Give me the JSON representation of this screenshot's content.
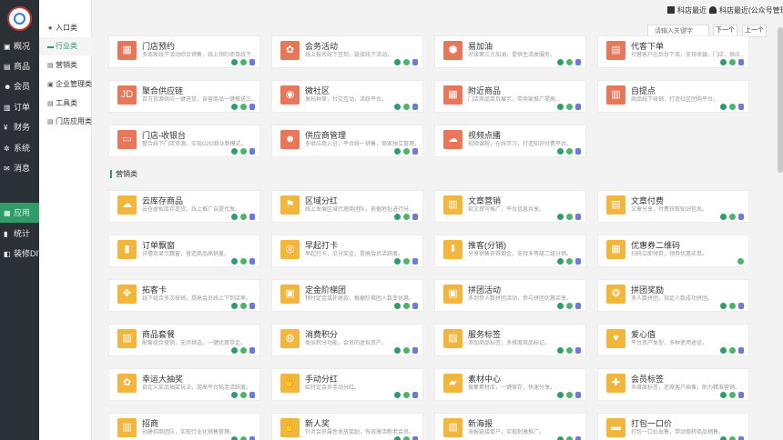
{
  "sidebar": {
    "items": [
      {
        "label": "概况",
        "icon": "home-icon",
        "glyph": "▣"
      },
      {
        "label": "商品",
        "icon": "goods-icon",
        "glyph": "▤"
      },
      {
        "label": "会员",
        "icon": "members-icon",
        "glyph": "☻"
      },
      {
        "label": "订单",
        "icon": "orders-icon",
        "glyph": "▥"
      },
      {
        "label": "财务",
        "icon": "finance-icon",
        "glyph": "¥"
      },
      {
        "label": "系统",
        "icon": "system-icon",
        "glyph": "✲"
      },
      {
        "label": "消息",
        "icon": "messages-icon",
        "glyph": "✉"
      },
      {
        "label": "应用",
        "icon": "apps-icon",
        "glyph": "▦"
      },
      {
        "label": "统计",
        "icon": "stats-icon",
        "glyph": "▮"
      },
      {
        "label": "装修DIY",
        "icon": "diy-icon",
        "glyph": "◧"
      }
    ]
  },
  "subnav": {
    "items": [
      {
        "label": "入口类",
        "glyph": "★"
      },
      {
        "label": "行业类",
        "glyph": "▬"
      },
      {
        "label": "营销类",
        "glyph": "▤"
      },
      {
        "label": "企业管理类",
        "glyph": "▣"
      },
      {
        "label": "工具类",
        "glyph": "▤"
      },
      {
        "label": "门店应用类",
        "glyph": "▤"
      }
    ]
  },
  "topbar": {
    "recent_label": "科店最近",
    "account_label": "科店最近(公众号管理员)"
  },
  "search": {
    "placeholder": "请输入关键字",
    "next_label": "下一个",
    "prev_label": "上一个"
  },
  "sections": [
    {
      "title": "",
      "color": "#e8775a",
      "cards": [
        {
          "title": "门店预约",
          "desc": "多商家线下活动综合销售，线上预约项目线下...",
          "glyph": "▦",
          "badges": [
            "g1",
            "g2",
            "p"
          ]
        },
        {
          "title": "会务活动",
          "desc": "线上报名线下签到，链接线下活动。",
          "glyph": "✿",
          "badges": [
            "g1",
            "g2",
            "p"
          ]
        },
        {
          "title": "易加油",
          "desc": "对接第三方加油，提供生活类服务。",
          "glyph": "⬢",
          "badges": [
            "g1",
            "g2",
            "p"
          ]
        },
        {
          "title": "代客下单",
          "desc": "代替客户在后台下单，支持收银，门店，供应...",
          "glyph": "▤",
          "badges": [
            "g1",
            "g2",
            "p"
          ]
        },
        {
          "title": "聚合供应链",
          "desc": "百万货源供应一键进货，自营商品一键推送三...",
          "glyph": "JD",
          "badges": [
            "g1",
            "g2",
            "p"
          ]
        },
        {
          "title": "微社区",
          "desc": "发帖种草，社交互动，活跃平台。",
          "glyph": "◉",
          "badges": [
            "g1",
            "g2",
            "p"
          ]
        },
        {
          "title": "附近商品",
          "desc": "门店商品单页展示，带商家推广提高...",
          "glyph": "▦",
          "badges": [
            "g1",
            "g2",
            "p"
          ]
        },
        {
          "title": "自提点",
          "desc": "商品线下核销，打造社区团购平台。",
          "glyph": "▥",
          "badges": [
            "g1",
            "g2",
            "p"
          ]
        },
        {
          "title": "门店-收银台",
          "desc": "整合线下门店资源，实现O2O商业新模式。",
          "glyph": "▭",
          "badges": [
            "g1",
            "g2",
            "p"
          ]
        },
        {
          "title": "供应商管理",
          "desc": "多供应商入驻，平台统一销售，商家独立管理。",
          "glyph": "☻",
          "badges": [
            "g1",
            "g2",
            "p"
          ]
        },
        {
          "title": "视频点播",
          "desc": "视频课程，在线学习，打造知识付费平台。",
          "glyph": "☁",
          "badges": [
            "g1",
            "g2",
            "p"
          ]
        }
      ]
    },
    {
      "title": "营销类",
      "color": "#f2b63d",
      "cards": [
        {
          "title": "云库存商品",
          "desc": "云仓虚拟库存提货，线上推广自提代发。",
          "glyph": "☁",
          "badges": [
            "g1",
            "g2",
            "p"
          ]
        },
        {
          "title": "区域分红",
          "desc": "线上发展区域代理商团队，依据地址进行分...",
          "glyph": "⚑",
          "badges": [
            "g1",
            "g2",
            "p"
          ]
        },
        {
          "title": "文章营销",
          "desc": "软文撰写推广，平台信息共享。",
          "glyph": "▥",
          "badges": [
            "g1",
            "g2",
            "p"
          ]
        },
        {
          "title": "文章付费",
          "desc": "文章分享，付费获取知识信息。",
          "glyph": "▤",
          "badges": [
            "g1",
            "g2",
            "p"
          ]
        },
        {
          "title": "订单飘窗",
          "desc": "详情页显示飘窗，营造商品高销量。",
          "glyph": "▮",
          "badges": [
            "g1",
            "g2",
            "p"
          ]
        },
        {
          "title": "早起打卡",
          "desc": "早起打卡，瓜分奖金，提高会员活跃度。",
          "glyph": "◎",
          "badges": [
            "g1",
            "g2",
            "p"
          ]
        },
        {
          "title": "推客(分销)",
          "desc": "分享销售获得佣金，支持多等级二级分销。",
          "glyph": "⬇",
          "badges": [
            "g1",
            "g2",
            "p"
          ]
        },
        {
          "title": "优惠券二维码",
          "desc": "扫码立即领券，领券优惠买单。",
          "glyph": "▦",
          "badges": [
            "g2"
          ]
        },
        {
          "title": "拓客卡",
          "desc": "线下组合多次核销，提高会员线上下到店率。",
          "glyph": "✥",
          "badges": [
            "g1",
            "g2",
            "p"
          ]
        },
        {
          "title": "定金阶梯团",
          "desc": "预付定金或补尾款，根据阶梯团人数变优惠。",
          "glyph": "▣",
          "badges": [
            "g1",
            "g2",
            "p"
          ]
        },
        {
          "title": "拼团活动",
          "desc": "多到参人数拼团活动，参与拼团优惠买享。",
          "glyph": "▣",
          "badges": [
            "g1",
            "g2",
            "p"
          ]
        },
        {
          "title": "拼团奖励",
          "desc": "多人数拼团，指定人数成功拼团。",
          "glyph": "❂",
          "badges": [
            "g1",
            "g2",
            "p"
          ]
        },
        {
          "title": "商品套餐",
          "desc": "配套组合营销，无须挑选，一键优惠带走。",
          "glyph": "▨",
          "badges": [
            "g1",
            "g2",
            "p"
          ]
        },
        {
          "title": "消费积分",
          "desc": "类似积分功能，会员的虚拟资产。",
          "glyph": "◍",
          "badges": [
            "g1",
            "g2",
            "p"
          ]
        },
        {
          "title": "服务标签",
          "desc": "添加商品标签，多维度商品标记。",
          "glyph": "▧",
          "badges": [
            "g1",
            "g2",
            "p"
          ]
        },
        {
          "title": "爱心值",
          "desc": "平台资产类型，多种使用途径。",
          "glyph": "♥",
          "badges": [
            "g1",
            "g2",
            "p"
          ]
        },
        {
          "title": "幸运大抽奖",
          "desc": "自定义奖品抽奖玩法，提高平台粘连活跃度。",
          "glyph": "✿",
          "badges": [
            "g1",
            "g2",
            "p"
          ]
        },
        {
          "title": "手动分红",
          "desc": "给特定会员手动分红。",
          "glyph": "✋",
          "badges": [
            "g1",
            "g2",
            "p"
          ]
        },
        {
          "title": "素材中心",
          "desc": "搜集素材库，一键保存，快速分享。",
          "glyph": "▰",
          "badges": [
            "g1",
            "g2",
            "p"
          ]
        },
        {
          "title": "会员标签",
          "desc": "多维度标签，还原客户画像，助力精准营销。",
          "glyph": "✚",
          "badges": [
            "g1",
            "g2",
            "p"
          ]
        },
        {
          "title": "招商",
          "desc": "创建招商团队，实现行业化销售管理。",
          "glyph": "▥",
          "badges": [
            "g1",
            "g2",
            "p"
          ]
        },
        {
          "title": "新人奖",
          "desc": "针对会员属性发放奖励，有效激活新老会员。",
          "glyph": "✋",
          "badges": [
            "g1",
            "g2",
            "p"
          ]
        },
        {
          "title": "新海报",
          "desc": "海报链接单户，实现刺激推广。",
          "glyph": "▧",
          "badges": [
            "g1",
            "g2",
            "p"
          ]
        },
        {
          "title": "打包一口价",
          "desc": "打包一口价出售，带动周转商品销售。",
          "glyph": "▬",
          "badges": [
            "g1",
            "g2",
            "p"
          ]
        }
      ]
    }
  ]
}
